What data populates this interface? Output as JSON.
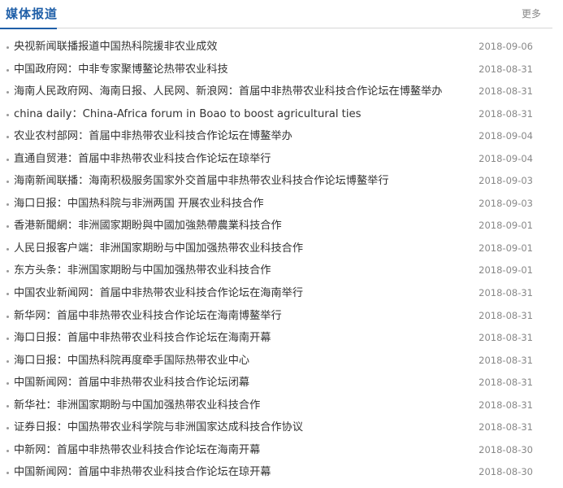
{
  "header": {
    "title": "媒体报道",
    "more_label": "更多"
  },
  "news": [
    {
      "title": "央视新闻联播报道中国热科院援非农业成效",
      "date": "2018-09-06"
    },
    {
      "title": "中国政府网：中非专家聚博鳌论热带农业科技",
      "date": "2018-08-31"
    },
    {
      "title": "海南人民政府网、海南日报、人民网、新浪网：首届中非热带农业科技合作论坛在博鳌举办",
      "date": "2018-08-31"
    },
    {
      "title": "china daily：China-Africa forum in Boao to boost agricultural ties",
      "date": "2018-08-31"
    },
    {
      "title": "农业农村部网：首届中非热带农业科技合作论坛在博鳌举办",
      "date": "2018-09-04"
    },
    {
      "title": "直通自贸港：首届中非热带农业科技合作论坛在琼举行",
      "date": "2018-09-04"
    },
    {
      "title": "海南新闻联播：海南积极服务国家外交首届中非热带农业科技合作论坛博鳌举行",
      "date": "2018-09-03"
    },
    {
      "title": "海口日报：中国热科院与非洲两国 开展农业科技合作",
      "date": "2018-09-03"
    },
    {
      "title": "香港新聞網：非洲國家期盼與中國加強熱帶農業科技合作",
      "date": "2018-09-01"
    },
    {
      "title": "人民日报客户端：非洲国家期盼与中国加强热带农业科技合作",
      "date": "2018-09-01"
    },
    {
      "title": "东方头条：非洲国家期盼与中国加强热带农业科技合作",
      "date": "2018-09-01"
    },
    {
      "title": "中国农业新闻网：首届中非热带农业科技合作论坛在海南举行",
      "date": "2018-08-31"
    },
    {
      "title": "新华网：首届中非热带农业科技合作论坛在海南博鳌举行",
      "date": "2018-08-31"
    },
    {
      "title": "海口日报：首届中非热带农业科技合作论坛在海南开幕",
      "date": "2018-08-31"
    },
    {
      "title": "海口日报：中国热科院再度牵手国际热带农业中心",
      "date": "2018-08-31"
    },
    {
      "title": "中国新闻网：首届中非热带农业科技合作论坛闭幕",
      "date": "2018-08-31"
    },
    {
      "title": "新华社：非洲国家期盼与中国加强热带农业科技合作",
      "date": "2018-08-31"
    },
    {
      "title": "证券日报：中国热带农业科学院与非洲国家达成科技合作协议",
      "date": "2018-08-31"
    },
    {
      "title": "中新网：首届中非热带农业科技合作论坛在海南开幕",
      "date": "2018-08-30"
    },
    {
      "title": "中国新闻网：首届中非热带农业科技合作论坛在琼开幕",
      "date": "2018-08-30"
    }
  ]
}
